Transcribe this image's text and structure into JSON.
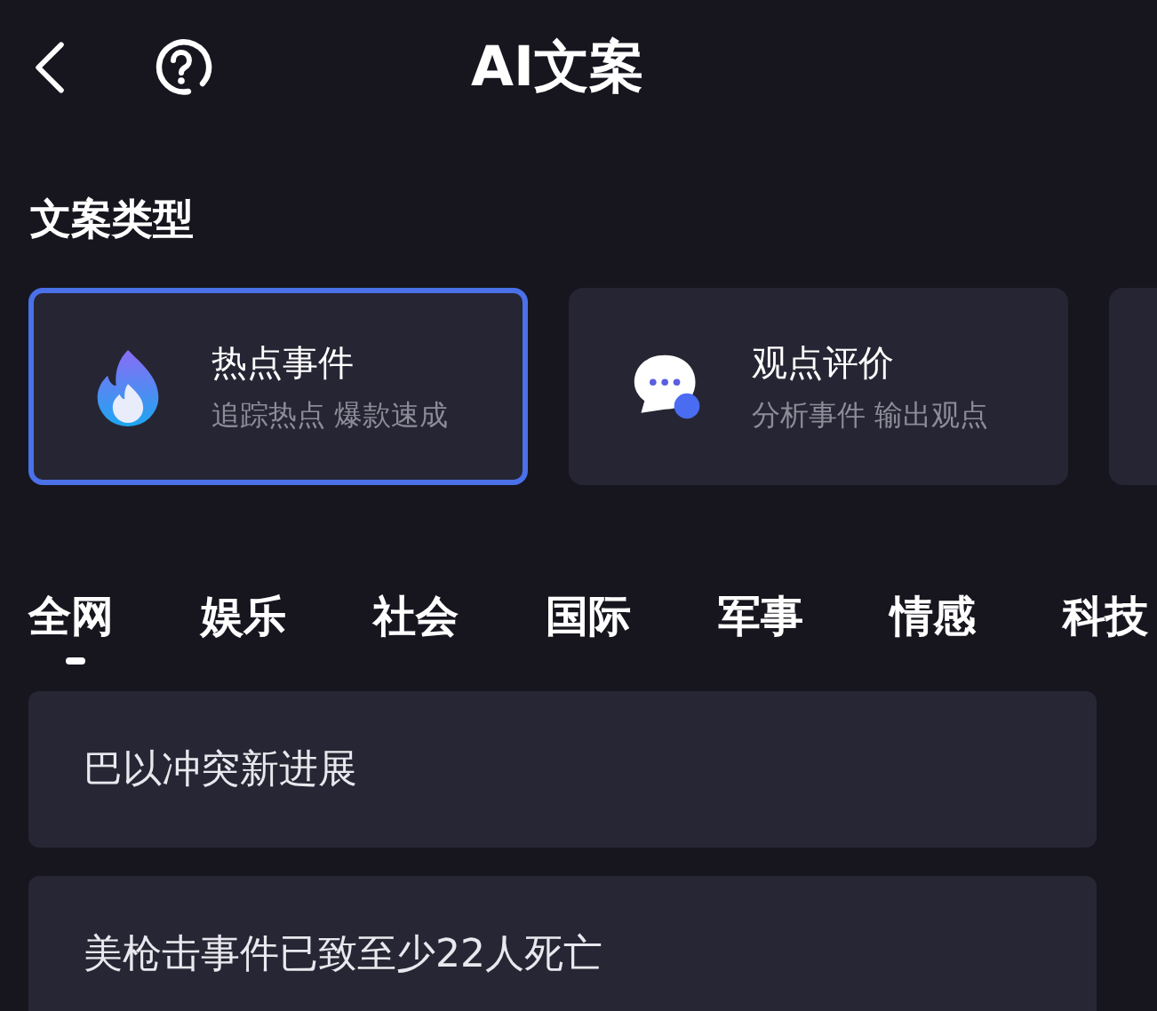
{
  "header": {
    "title": "AI文案"
  },
  "section_title": "文案类型",
  "cards": [
    {
      "kind": "fire",
      "title": "热点事件",
      "subtitle": "追踪热点 爆款速成",
      "selected": true
    },
    {
      "kind": "chat",
      "title": "观点评价",
      "subtitle": "分析事件 输出观点",
      "selected": false
    },
    {
      "kind": "partial",
      "selected": false
    }
  ],
  "tabs": [
    {
      "label": "全网",
      "selected": true
    },
    {
      "label": "娱乐",
      "selected": false
    },
    {
      "label": "社会",
      "selected": false
    },
    {
      "label": "国际",
      "selected": false
    },
    {
      "label": "军事",
      "selected": false
    },
    {
      "label": "情感",
      "selected": false
    },
    {
      "label": "科技",
      "selected": false
    }
  ],
  "topics": [
    "巴以冲突新进展",
    "美枪击事件已致至少22人死亡"
  ]
}
